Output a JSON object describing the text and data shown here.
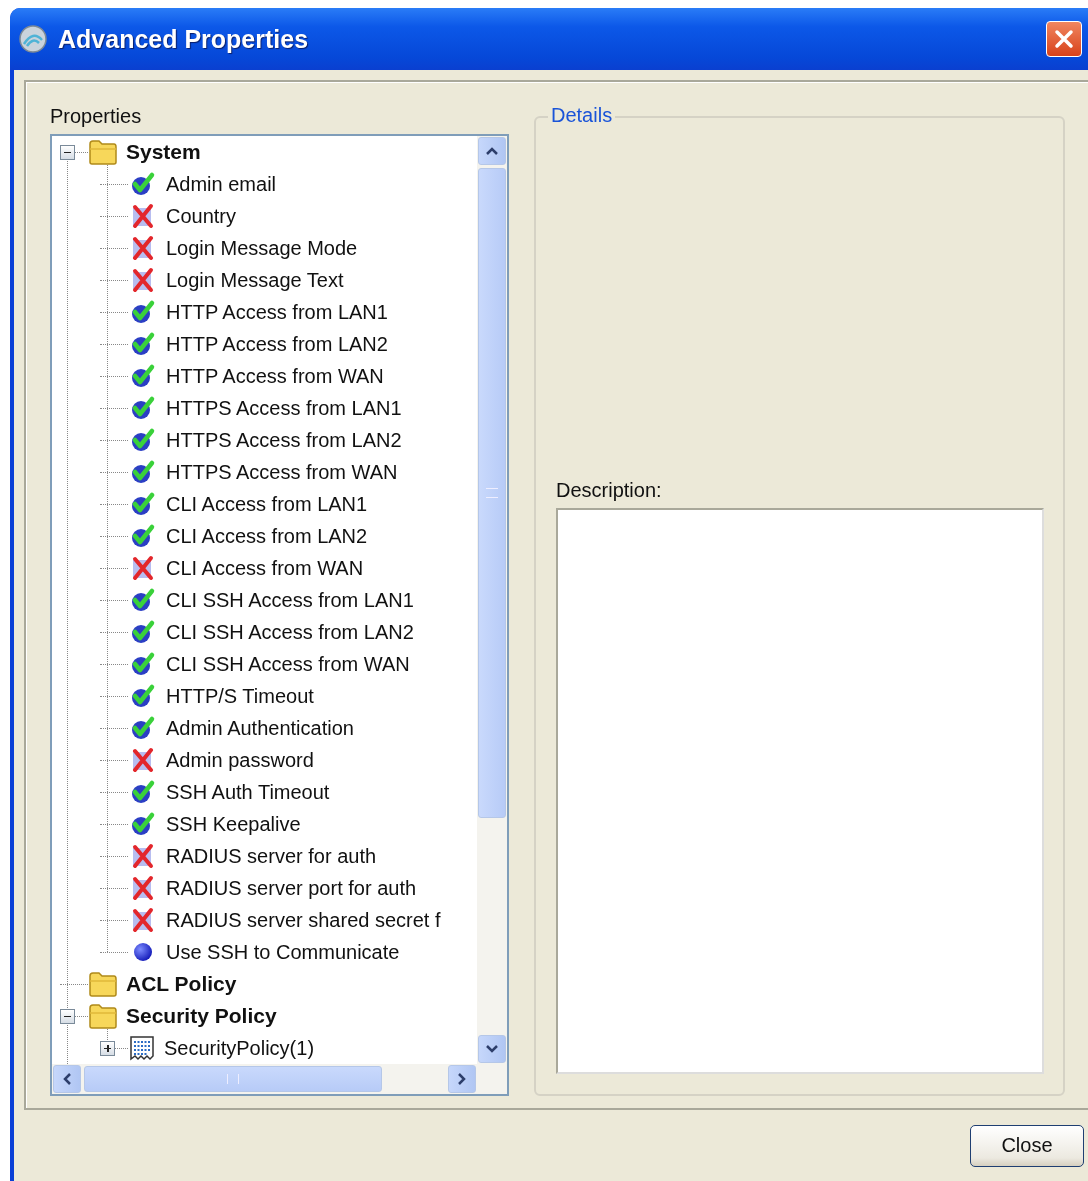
{
  "window": {
    "title": "Advanced Properties"
  },
  "properties": {
    "label": "Properties",
    "tree": [
      {
        "label": "System",
        "kind": "folder",
        "expanded": true,
        "children": [
          {
            "label": "Admin email",
            "kind": "check"
          },
          {
            "label": "Country",
            "kind": "cross"
          },
          {
            "label": "Login Message Mode",
            "kind": "cross"
          },
          {
            "label": "Login Message Text",
            "kind": "cross"
          },
          {
            "label": "HTTP Access from LAN1",
            "kind": "check"
          },
          {
            "label": "HTTP Access from LAN2",
            "kind": "check"
          },
          {
            "label": "HTTP Access from WAN",
            "kind": "check"
          },
          {
            "label": "HTTPS Access from LAN1",
            "kind": "check"
          },
          {
            "label": "HTTPS Access from LAN2",
            "kind": "check"
          },
          {
            "label": "HTTPS Access from WAN",
            "kind": "check"
          },
          {
            "label": "CLI Access from LAN1",
            "kind": "check"
          },
          {
            "label": "CLI Access from LAN2",
            "kind": "check"
          },
          {
            "label": "CLI Access from WAN",
            "kind": "cross"
          },
          {
            "label": "CLI SSH Access from LAN1",
            "kind": "check"
          },
          {
            "label": "CLI SSH Access from LAN2",
            "kind": "check"
          },
          {
            "label": "CLI SSH Access from WAN",
            "kind": "check"
          },
          {
            "label": "HTTP/S Timeout",
            "kind": "check"
          },
          {
            "label": "Admin Authentication",
            "kind": "check"
          },
          {
            "label": "Admin password",
            "kind": "cross"
          },
          {
            "label": "SSH Auth Timeout",
            "kind": "check"
          },
          {
            "label": "SSH Keepalive",
            "kind": "check"
          },
          {
            "label": "RADIUS server for auth",
            "kind": "cross"
          },
          {
            "label": "RADIUS server port for auth",
            "kind": "cross"
          },
          {
            "label": "RADIUS server shared secret f",
            "kind": "cross"
          },
          {
            "label": "Use SSH to Communicate",
            "kind": "dot"
          }
        ]
      },
      {
        "label": "ACL Policy",
        "kind": "folder"
      },
      {
        "label": "Security Policy",
        "kind": "folder",
        "expanded": true,
        "children": [
          {
            "label": "SecurityPolicy(1)",
            "kind": "list",
            "expanded": false
          }
        ]
      }
    ]
  },
  "details": {
    "legend": "Details",
    "description_label": "Description:"
  },
  "buttons": [
    {
      "label": "Close"
    }
  ]
}
